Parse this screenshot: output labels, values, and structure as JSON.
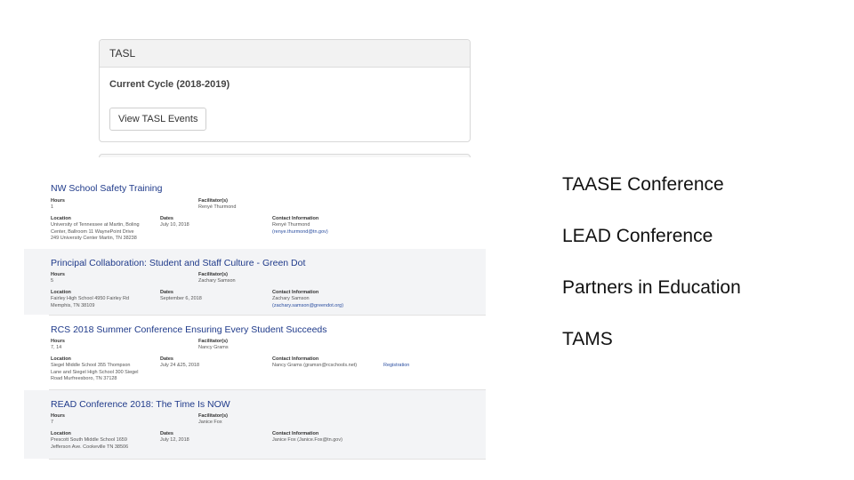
{
  "tasl": {
    "header": "TASL",
    "cycle": "Current Cycle (2018-2019)",
    "button": "View TASL Events"
  },
  "labels": {
    "hours": "Hours",
    "facilitators": "Facilitator(s)",
    "location": "Location",
    "dates": "Dates",
    "contact": "Contact Information"
  },
  "events": [
    {
      "title": "NW School Safety Training",
      "hours": "1",
      "facilitator": "Renyé Thurmond",
      "location": [
        "University of Tennessee at Martin, Boling",
        "Center, Ballroom 11 WaynePoint Drive",
        "249 University Center Martin, TN 38238"
      ],
      "dates": "July 10, 2018",
      "contact": [
        "Renyé Thurmond",
        "(renye.thurmond@tn.gov)"
      ],
      "registration": ""
    },
    {
      "title": "Principal Collaboration: Student and Staff Culture - Green Dot",
      "hours": "5",
      "facilitator": "Zachary Samson",
      "location": [
        "Fairley High School 4950 Fairley Rd",
        "Memphis, TN 38109"
      ],
      "dates": "September 6, 2018",
      "contact": [
        "Zachary Samson",
        "(zachary.samson@greendot.org)"
      ],
      "registration": ""
    },
    {
      "title": "RCS 2018 Summer Conference Ensuring Every Student Succeeds",
      "hours": "7, 14",
      "facilitator": "Nancy Grams",
      "location": [
        "Siegel Middle School 355 Thompson",
        "Lane and Siegel High School 300 Siegel",
        "Road Murfreesboro, TN 37128"
      ],
      "dates": "July 24 &25, 2018",
      "contact": [
        "Nancy Grams (gramsn@rcschools.net)"
      ],
      "registration": "Registration"
    },
    {
      "title": "READ Conference 2018: The Time Is NOW",
      "hours": "7",
      "facilitator": "Janice Fox",
      "location": [
        "Prescott South Middle School 1659",
        "Jefferson Ave. Cookeville TN 38506"
      ],
      "dates": "July 12, 2018",
      "contact": [
        "Janice Fox (Janice.Fox@tn.gov)"
      ],
      "registration": ""
    }
  ],
  "right_list": [
    "TAASE Conference",
    "LEAD Conference",
    "Partners in Education",
    "TAMS"
  ]
}
